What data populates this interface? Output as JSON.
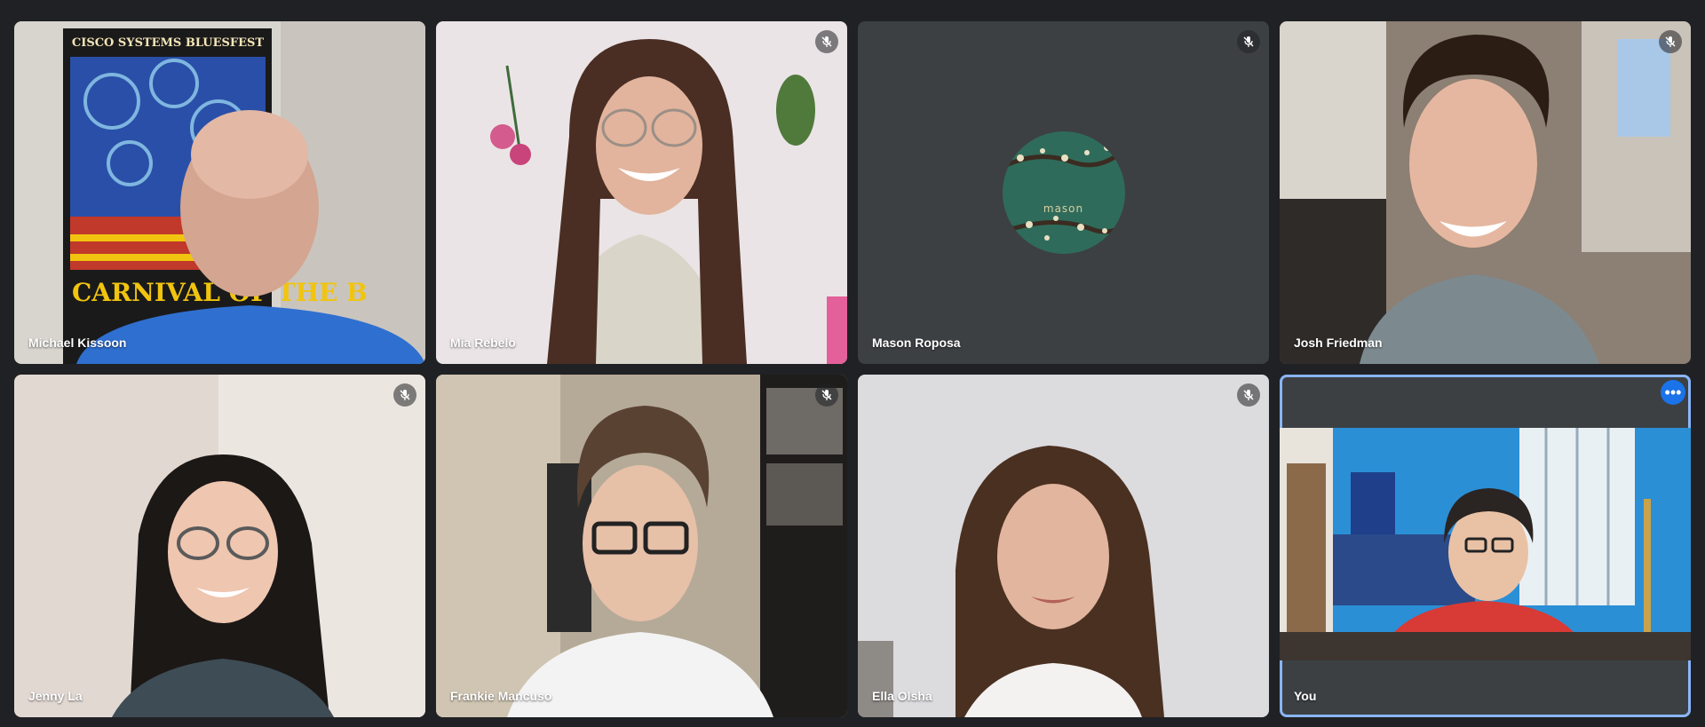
{
  "participants": [
    {
      "name": "Michael Kissoon",
      "muted": false,
      "poster_title": "CISCO SYSTEMS BLUESFEST",
      "poster_text": "CARNIVAL OF THE B"
    },
    {
      "name": "Mia Rebelo",
      "muted": true
    },
    {
      "name": "Mason Roposa",
      "muted": true,
      "camera_off": true,
      "avatar_text": "mason"
    },
    {
      "name": "Josh Friedman",
      "muted": true
    },
    {
      "name": "Jenny La",
      "muted": true
    },
    {
      "name": "Frankie Mancuso",
      "muted": true
    },
    {
      "name": "Ella Olsha",
      "muted": true
    },
    {
      "name": "You",
      "muted": false,
      "self": true,
      "more_label": "•••"
    }
  ],
  "colors": {
    "background": "#202124",
    "tile": "#3c4043",
    "active_outline": "#8ab4f8",
    "more_button": "#1a73e8"
  },
  "icons": {
    "mute": "mic-off-icon",
    "more": "more-options-icon"
  }
}
